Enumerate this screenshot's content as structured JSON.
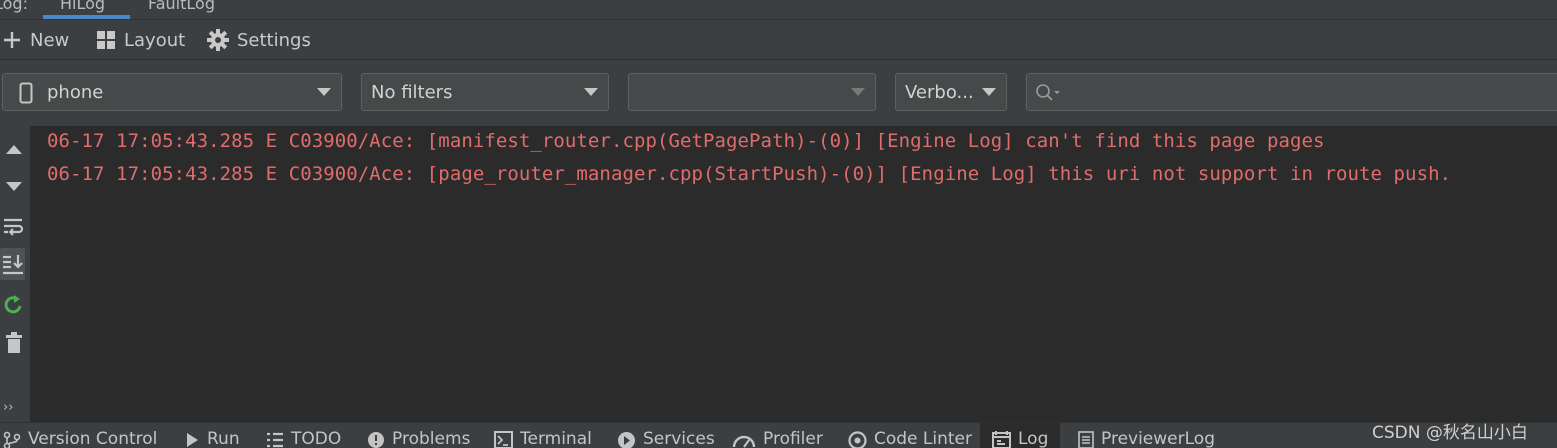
{
  "tabs": [
    {
      "label": "Log:"
    },
    {
      "label": "HiLog",
      "active": true
    },
    {
      "label": "FaultLog"
    }
  ],
  "toolbar": {
    "new_label": "New",
    "layout_label": "Layout",
    "settings_label": "Settings"
  },
  "filters": {
    "device": "phone",
    "filter": "No filters",
    "process": "",
    "level": "Verbo...",
    "search_value": ""
  },
  "log_lines": [
    "06-17 17:05:43.285 E C03900/Ace: [manifest_router.cpp(GetPagePath)-(0)] [Engine Log] can't find this page pages",
    "06-17 17:05:43.285 E C03900/Ace: [page_router_manager.cpp(StartPush)-(0)] [Engine Log] this uri not support in route push."
  ],
  "sidebar": {
    "more": "››"
  },
  "status_tabs": [
    {
      "label": "Version Control",
      "icon": "branch-icon"
    },
    {
      "label": "Run",
      "icon": "play-icon"
    },
    {
      "label": "TODO",
      "icon": "list-icon"
    },
    {
      "label": "Problems",
      "icon": "warning-icon"
    },
    {
      "label": "Terminal",
      "icon": "terminal-icon"
    },
    {
      "label": "Services",
      "icon": "services-icon"
    },
    {
      "label": "Profiler",
      "icon": "gauge-icon"
    },
    {
      "label": "Code Linter",
      "icon": "linter-icon"
    },
    {
      "label": "Log",
      "icon": "log-icon",
      "active": true
    },
    {
      "label": "PreviewerLog",
      "icon": "document-icon"
    }
  ],
  "watermark": "CSDN @秋名山小白",
  "colors": {
    "log_error": "#e06c6c",
    "panel": "#3c3f41",
    "editor_bg": "#2b2b2b",
    "tab_underline": "#4a88c7",
    "icon_green": "#4caf50"
  }
}
